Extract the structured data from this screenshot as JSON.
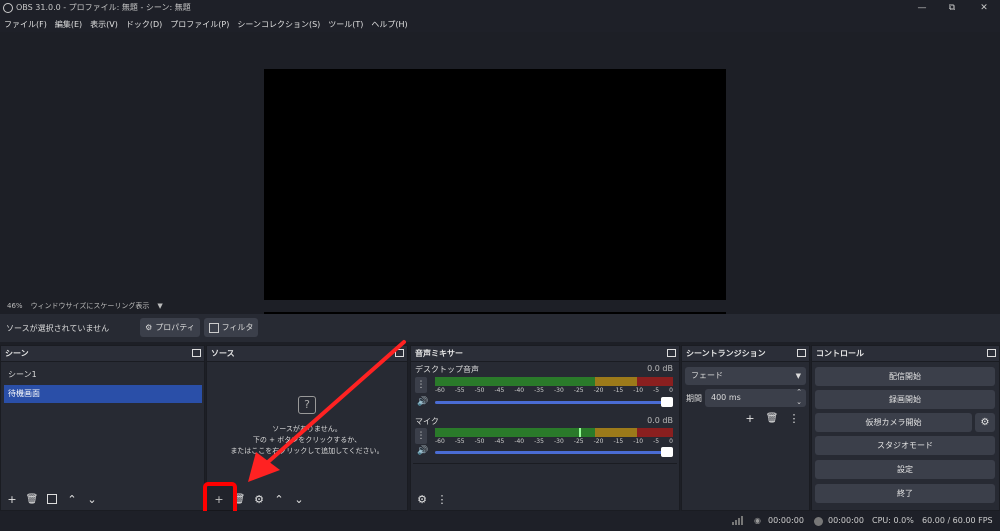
{
  "window": {
    "title": "OBS 31.0.0 - プロファイル: 無題 - シーン: 無題",
    "minimize": "—",
    "maximize": "⧉",
    "close": "✕"
  },
  "menu": [
    "ファイル(F)",
    "編集(E)",
    "表示(V)",
    "ドック(D)",
    "プロファイル(P)",
    "シーンコレクション(S)",
    "ツール(T)",
    "ヘルプ(H)"
  ],
  "preview": {
    "zoom": "46%",
    "scaling_mode": "ウィンドウサイズにスケーリング表示"
  },
  "source_bar": {
    "no_source": "ソースが選択されていません",
    "properties": "プロパティ",
    "filters": "フィルタ"
  },
  "scenes": {
    "title": "シーン",
    "items": [
      "シーン1",
      "待機画面"
    ],
    "selected_index": 1
  },
  "sources": {
    "title": "ソース",
    "empty_line1": "ソースがありません。",
    "empty_line2": "下の + ボタンをクリックするか、",
    "empty_line3": "またはここを右クリックして追加してください。"
  },
  "mixer": {
    "title": "音声ミキサー",
    "scale": [
      "-60",
      "-55",
      "-50",
      "-45",
      "-40",
      "-35",
      "-30",
      "-25",
      "-20",
      "-15",
      "-10",
      "-5",
      "0"
    ],
    "channels": [
      {
        "name": "デスクトップ音声",
        "db": "0.0 dB",
        "volume": 1.0
      },
      {
        "name": "マイク",
        "db": "0.0 dB",
        "volume": 1.0
      }
    ]
  },
  "transitions": {
    "title": "シーントランジション",
    "selected": "フェード",
    "duration_label": "期間",
    "duration": "400 ms"
  },
  "controls": {
    "title": "コントロール",
    "start_streaming": "配信開始",
    "start_recording": "録画開始",
    "start_virtual_cam": "仮想カメラ開始",
    "studio_mode": "スタジオモード",
    "settings": "設定",
    "exit": "終了"
  },
  "status": {
    "stream_time": "00:00:00",
    "record_time": "00:00:00",
    "cpu": "CPU: 0.0%",
    "fps": "60.00 / 60.00 FPS"
  },
  "colors": {
    "accent_selected": "#2a4fa8",
    "highlight_box": "#ff0000",
    "arrow": "#ff2222"
  }
}
